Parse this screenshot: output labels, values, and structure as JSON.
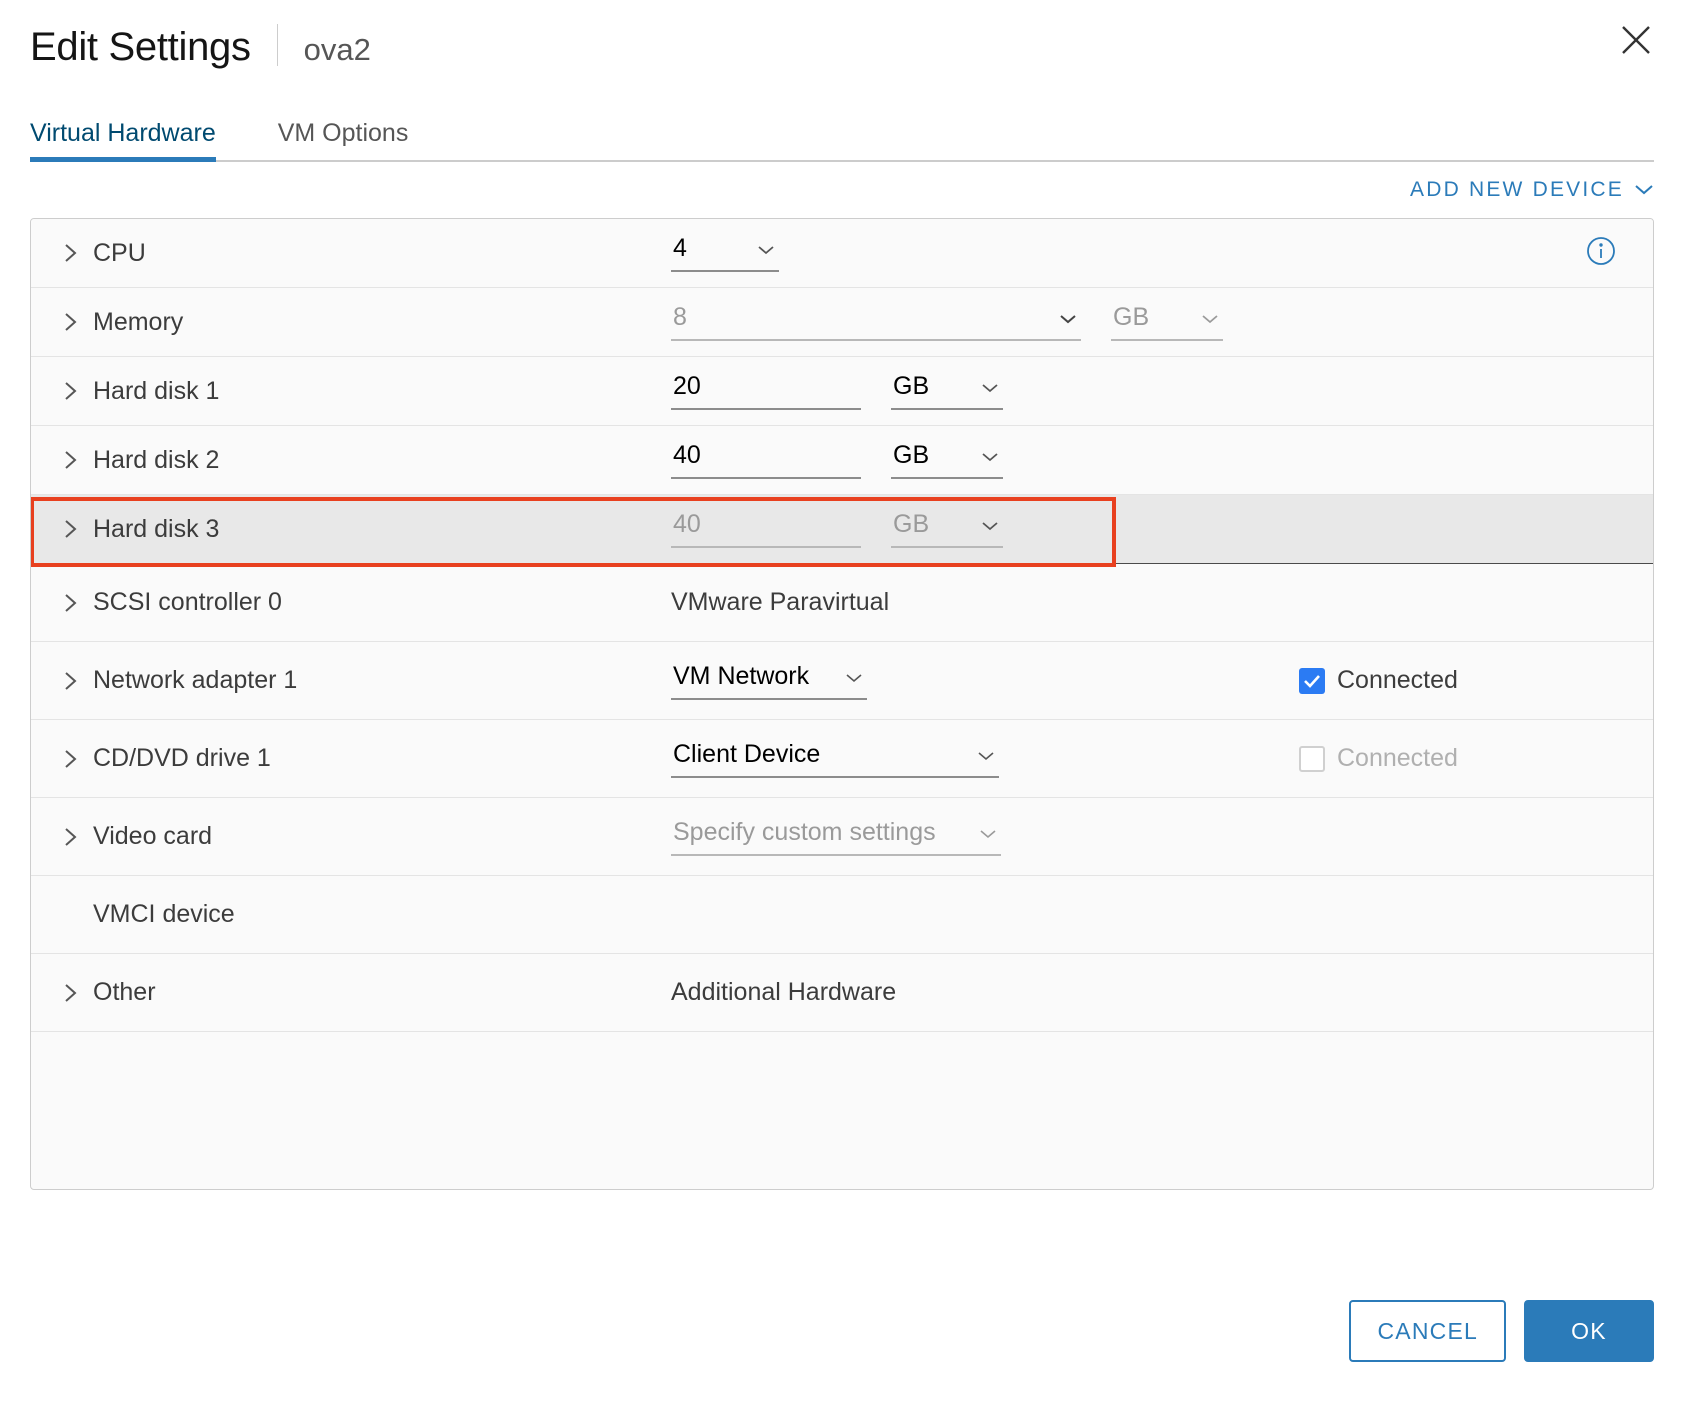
{
  "header": {
    "title": "Edit Settings",
    "subtitle": "ova2",
    "close_icon": "close-icon"
  },
  "tabs": [
    {
      "label": "Virtual Hardware",
      "active": true
    },
    {
      "label": "VM Options",
      "active": false
    }
  ],
  "toolbar": {
    "add_device_label": "ADD NEW DEVICE",
    "add_device_chevron": "chevron-down-icon"
  },
  "devices": [
    {
      "name": "CPU",
      "value": "4",
      "unit": null,
      "info_icon": "info-circle-icon",
      "disabled": false
    },
    {
      "name": "Memory",
      "value": "8",
      "unit": "GB",
      "disabled": true
    },
    {
      "name": "Hard disk 1",
      "value": "20",
      "unit": "GB",
      "disabled": false
    },
    {
      "name": "Hard disk 2",
      "value": "40",
      "unit": "GB",
      "disabled": false
    },
    {
      "name": "Hard disk 3",
      "value": "40",
      "unit": "GB",
      "disabled": true,
      "selected": true,
      "highlighted": true
    },
    {
      "name": "SCSI controller 0",
      "value": "VMware Paravirtual",
      "type": "text"
    },
    {
      "name": "Network adapter 1",
      "value": "VM Network",
      "type": "select",
      "checkbox": {
        "label": "Connected",
        "checked": true,
        "disabled": false
      }
    },
    {
      "name": "CD/DVD drive 1",
      "value": "Client Device",
      "type": "select",
      "checkbox": {
        "label": "Connected",
        "checked": false,
        "disabled": true
      }
    },
    {
      "name": "Video card",
      "value": "Specify custom settings",
      "type": "select",
      "disabled": true
    },
    {
      "name": "VMCI device",
      "value": "",
      "type": "none",
      "expandable": false
    },
    {
      "name": "Other",
      "value": "Additional Hardware",
      "type": "text"
    }
  ],
  "footer": {
    "cancel_label": "CANCEL",
    "ok_label": "OK"
  },
  "colors": {
    "accent": "#2b7bb9",
    "annotation": "#e8401f",
    "checkbox_checked": "#2b7bf3",
    "selected_row": "#e8e8e8"
  }
}
